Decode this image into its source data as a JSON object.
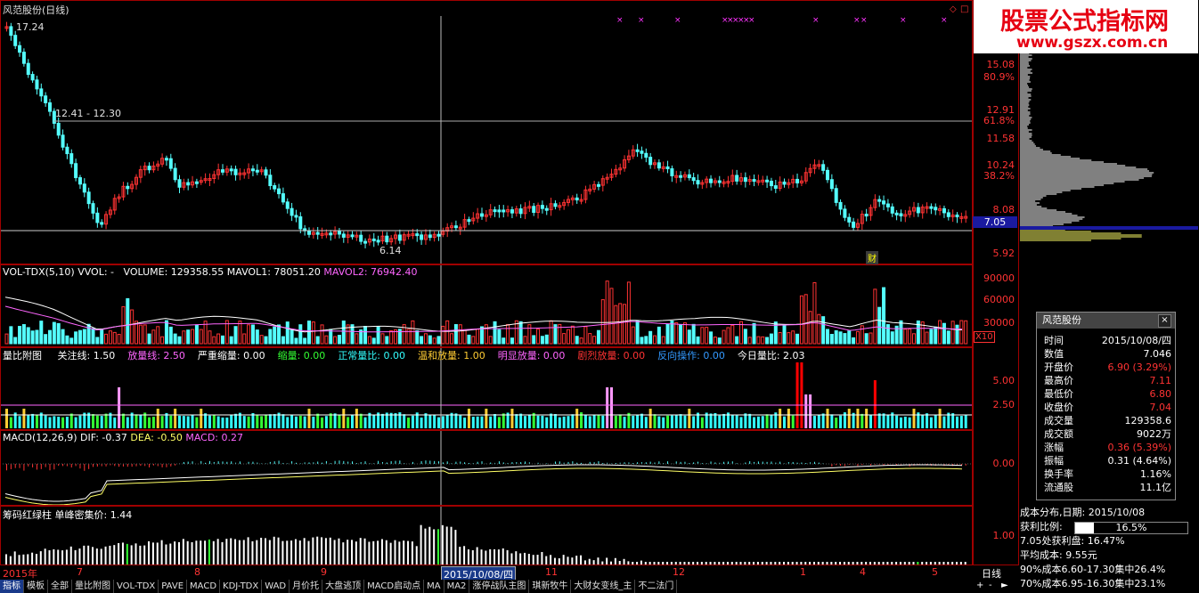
{
  "main": {
    "title": "风范股份(日线)",
    "high_label": "17.24",
    "range_label": "12.41 - 12.30",
    "low_label": "6.14",
    "price_axis": [
      "15.08",
      "80.9%",
      "12.91",
      "61.8%",
      "11.58",
      "10.24",
      "38.2%",
      "8.08",
      "7.05",
      "5.92"
    ],
    "current_price": "7.05",
    "news_badge": "财"
  },
  "vol": {
    "header_name": "VOL-TDX(5,10)",
    "header_vvol": "VVOL: -",
    "header_volume": "VOLUME: 129358.55",
    "header_mavol1": "MAVOL1: 78051.20",
    "header_mavol2": "MAVOL2: 76942.40",
    "axis": [
      "90000",
      "60000",
      "30000"
    ],
    "unit": "X10"
  },
  "ratio": {
    "header_name": "量比附图",
    "items": [
      {
        "label": "关注线: 1.50",
        "color": "#ffffff"
      },
      {
        "label": "放量线: 2.50",
        "color": "#ff66ff"
      },
      {
        "label": "严重缩量: 0.00",
        "color": "#ffffff"
      },
      {
        "label": "缩量: 0.00",
        "color": "#33ff33"
      },
      {
        "label": "正常量比: 0.00",
        "color": "#33ffff"
      },
      {
        "label": "温和放量: 1.00",
        "color": "#ffcc33"
      },
      {
        "label": "明显放量: 0.00",
        "color": "#ff66ff"
      },
      {
        "label": "剧烈放量: 0.00",
        "color": "#ff3333"
      },
      {
        "label": "反向操作: 0.00",
        "color": "#3399ff"
      },
      {
        "label": "今日量比: 2.03",
        "color": "#ffffff"
      }
    ],
    "axis": [
      "5.00",
      "2.50"
    ]
  },
  "macd": {
    "header_name": "MACD(12,26,9)",
    "dif": "DIF: -0.37",
    "dea": "DEA: -0.50",
    "macd": "MACD: 0.27",
    "axis": [
      "0.00"
    ]
  },
  "chip": {
    "header": "筹码红绿柱  单峰密集价: 1.44",
    "axis": [
      "1.00"
    ]
  },
  "date_axis": {
    "labels": [
      "2015年",
      "7",
      "8",
      "9",
      "2015/10/08/四",
      "11",
      "12",
      "1",
      "4",
      "5"
    ],
    "period": "日线"
  },
  "tabs": [
    "指标",
    "模板",
    "全部",
    "量比附图",
    "VOL-TDX",
    "PAVE",
    "MACD",
    "KDJ-TDX",
    "WAD",
    "月价托",
    "大盘逃顶",
    "MACD启动点",
    "MA",
    "MA2",
    "涨停战队主图",
    "琪新牧牛",
    "大财女变线_主",
    "不二法门"
  ],
  "info_panel": {
    "title": "风范股份",
    "close": "×",
    "rows": [
      {
        "k": "时间",
        "v": "2015/10/08/四",
        "color": "#ffffff"
      },
      {
        "k": "数值",
        "v": "7.046",
        "color": "#ffffff"
      },
      {
        "k": "开盘价",
        "v": "6.90 (3.29%)",
        "color": "#ff3333"
      },
      {
        "k": "最高价",
        "v": "7.11",
        "color": "#ff3333"
      },
      {
        "k": "最低价",
        "v": "6.80",
        "color": "#ff3333"
      },
      {
        "k": "收盘价",
        "v": "7.04",
        "color": "#ff3333"
      },
      {
        "k": "成交量",
        "v": "129358.6",
        "color": "#ffffff"
      },
      {
        "k": "成交额",
        "v": "9022万",
        "color": "#ffffff"
      },
      {
        "k": "涨幅",
        "v": "0.36 (5.39%)",
        "color": "#ff3333"
      },
      {
        "k": "振幅",
        "v": "0.31 (4.64%)",
        "color": "#ffffff"
      },
      {
        "k": "换手率",
        "v": "1.16%",
        "color": "#ffffff"
      },
      {
        "k": "流通股",
        "v": "11.1亿",
        "color": "#ffffff"
      }
    ]
  },
  "cost": {
    "header": "成本分布,日期: 2015/10/08",
    "profit_label": "获利比例:",
    "profit_value": "16.5%",
    "profit_fraction": 0.165,
    "lines": [
      "7.05处获利盘: 16.47%",
      "平均成本: 9.55元",
      "90%成本6.60-17.30集中26.4%",
      "70%成本6.95-16.30集中23.1%"
    ]
  },
  "logo": {
    "line1": "股票公式指标网",
    "line2": "www.gszx.com.cn"
  },
  "colors": {
    "up": "#ff3333",
    "down": "#54ffff",
    "grid": "#a00000",
    "magenta": "#ff33ff",
    "yellow": "#ffff66"
  }
}
